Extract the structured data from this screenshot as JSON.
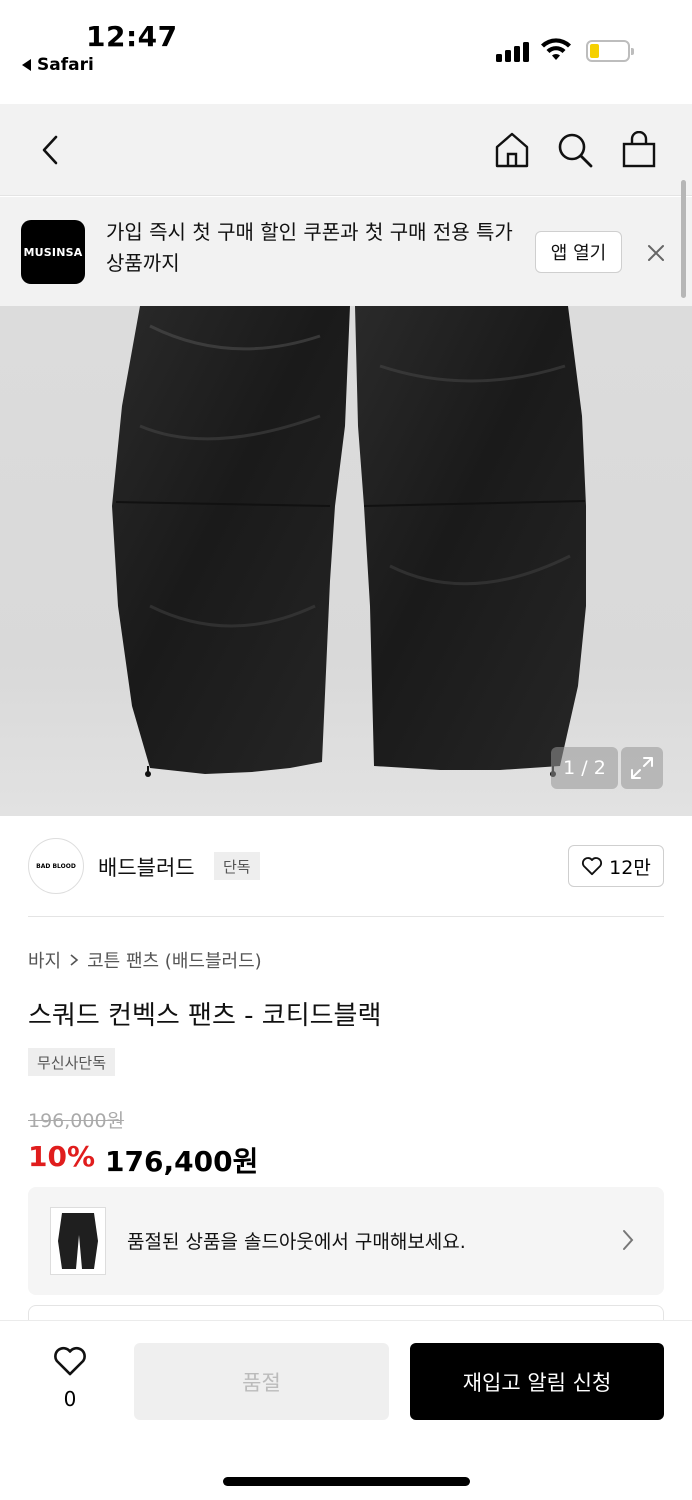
{
  "status_bar": {
    "time": "12:47",
    "back_app": "Safari"
  },
  "banner": {
    "logo_text": "MUSINSA",
    "text": "가입 즉시 첫 구매 할인 쿠폰과 첫 구매 전용 특가 상품까지",
    "open_app_label": "앱 열기"
  },
  "gallery": {
    "page_indicator": "1 / 2"
  },
  "brand": {
    "logo_text": "BAD BLOOD",
    "name": "배드블러드",
    "tag": "단독",
    "likes": "12만"
  },
  "product": {
    "breadcrumb": [
      "바지",
      "코튼 팬츠 (배드블러드)"
    ],
    "title": "스쿼드 컨벡스 팬츠 - 코티드블랙",
    "exclusive_tag": "무신사단독",
    "original_price": "196,000원",
    "discount": "10%",
    "sale_price": "176,400원"
  },
  "soldout_card": {
    "text": "품절된 상품을 솔드아웃에서 구매해보세요."
  },
  "bottom_bar": {
    "wish_count": "0",
    "soldout_label": "품절",
    "restock_label": "재입고 알림 신청"
  },
  "colors": {
    "discount": "#e01d1d",
    "primary_button": "#000000",
    "banner_bg": "#f2f2f2"
  }
}
